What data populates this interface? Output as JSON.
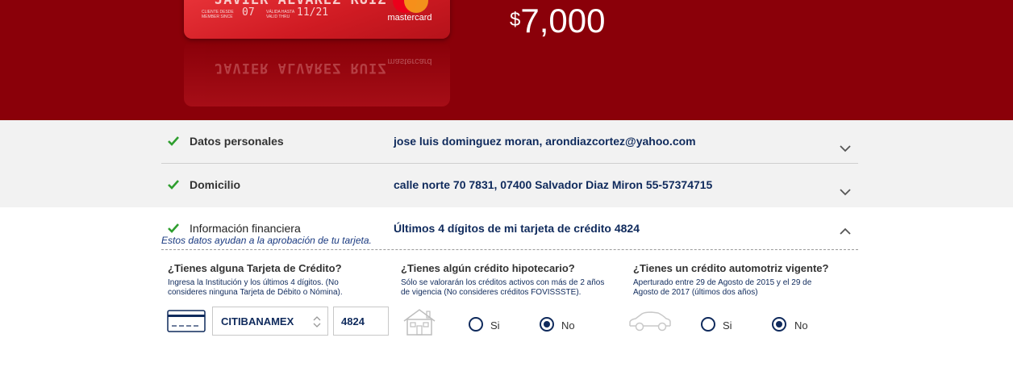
{
  "hero": {
    "card": {
      "name": "JAVIER ALVAREZ RUIZ",
      "member_since_label": "CLIENTE DESDE MEMBER SINCE",
      "member_since_value": "07",
      "valid_thru_label": "VÁLIDA HASTA VALID THRU",
      "valid_thru_value": "11/21",
      "brand": "mastercard"
    },
    "amount_currency": "$",
    "amount_value": "7,000"
  },
  "sections": {
    "personal": {
      "title": "Datos personales",
      "summary": "jose luis dominguez moran, arondiazcortez@yahoo.com"
    },
    "address": {
      "title": "Domicilio",
      "summary": "calle norte 70 7831, 07400 Salvador Diaz Miron 55-57374715"
    },
    "financial": {
      "title": "Información financiera",
      "summary": "Últimos 4 dígitos de mi tarjeta de crédito 4824",
      "note": "Estos datos ayudan a la aprobación de tu tarjeta."
    }
  },
  "questions": {
    "credit_card": {
      "title": "¿Tienes alguna Tarjeta de Crédito?",
      "help_line1": "Ingresa la Institución y los últimos 4 dígitos. (No",
      "help_line2": "consideres ninguna Tarjeta de Débito o Nómina).",
      "institution": "CITIBANAMEX",
      "last_digits": "4824"
    },
    "mortgage": {
      "title": "¿Tienes algún crédito hipotecario?",
      "help_line1": "Sólo se valorarán los créditos activos con más de 2 años",
      "help_line2": "de vigencia (No consideres créditos FOVISSSTE).",
      "yes_label": "Si",
      "no_label": "No",
      "selected": "No"
    },
    "auto": {
      "title": "¿Tienes un crédito automotriz vigente?",
      "help_line1": "Aperturado entre 29 de Agosto de 2015 y el 29 de",
      "help_line2": "Agosto de 2017 (últimos dos años)",
      "yes_label": "Si",
      "no_label": "No",
      "selected": "No"
    }
  },
  "colors": {
    "hero_bg": "#8a0009",
    "text_blue": "#0f2a5c",
    "check_green": "#2e9e2e"
  }
}
